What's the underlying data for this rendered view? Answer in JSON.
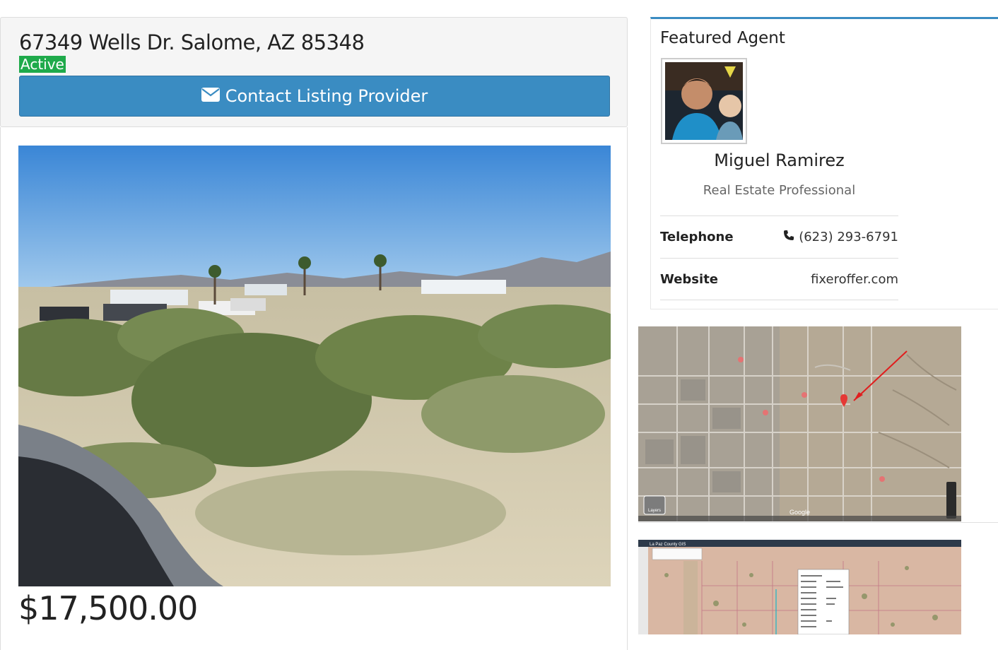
{
  "listing": {
    "address": "67349 Wells Dr. Salome, AZ 85348",
    "status": "Active",
    "contact_button_label": "Contact Listing Provider",
    "price": "$17,500.00"
  },
  "agent": {
    "heading": "Featured Agent",
    "name": "Miguel Ramirez",
    "role": "Real Estate Professional",
    "telephone_label": "Telephone",
    "telephone": "(623) 293-6791",
    "website_label": "Website",
    "website": "fixeroffer.com"
  },
  "map": {
    "google_label": "Google",
    "layers_label": "Layers"
  },
  "gis": {
    "title": "La Paz County GIS"
  },
  "colors": {
    "primary_button": "#3a8cc2",
    "status_active": "#1faa4b",
    "agent_card_accent": "#3a8cc2"
  },
  "icons": {
    "contact": "envelope-icon",
    "telephone": "phone-icon"
  }
}
